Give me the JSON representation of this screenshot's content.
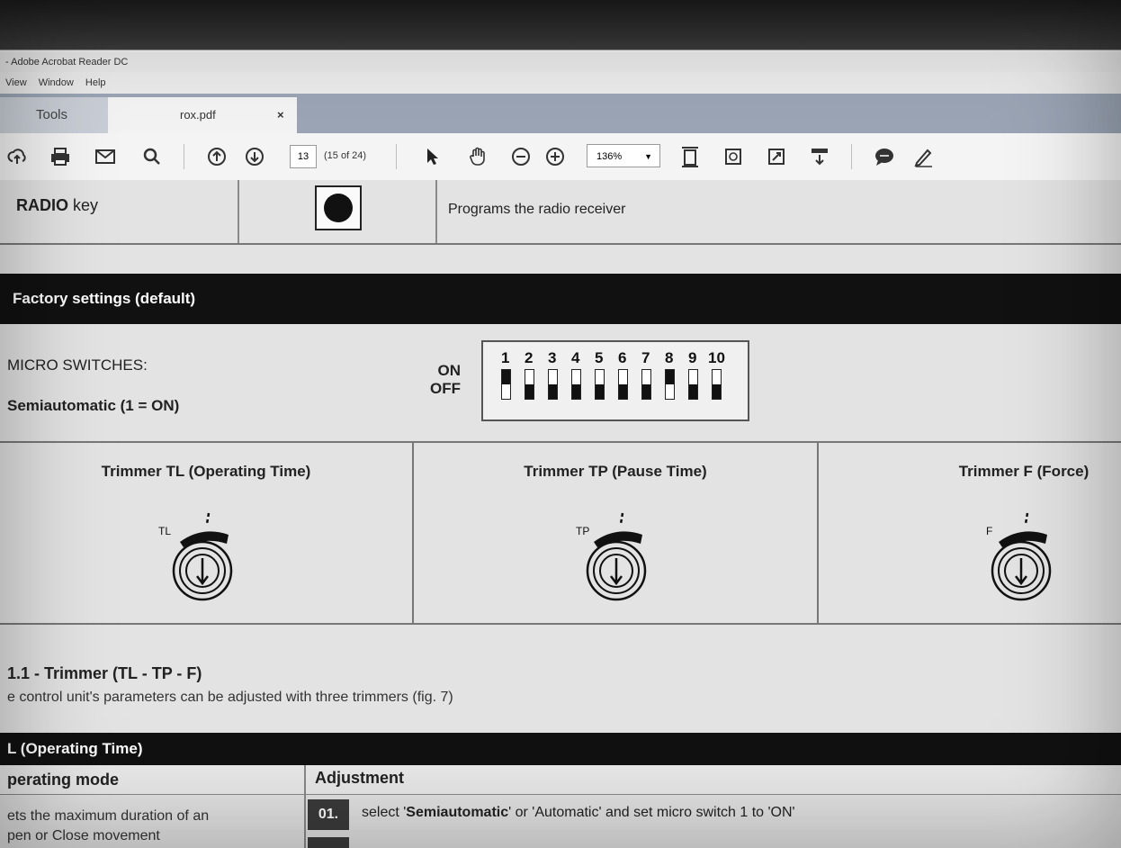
{
  "window": {
    "title": "- Adobe Acrobat Reader DC"
  },
  "menu": {
    "items": [
      "View",
      "Window",
      "Help"
    ]
  },
  "tabs": {
    "tools_label": "Tools",
    "doc_label": "rox.pdf",
    "close_label": "×"
  },
  "toolbar": {
    "page_current": "13",
    "page_of": "(15 of 24)",
    "zoom": "136%",
    "icons": [
      "cloud-upload-icon",
      "print-icon",
      "email-icon",
      "search-icon",
      "page-up-icon",
      "page-down-icon",
      "select-cursor-icon",
      "hand-tool-icon",
      "zoom-out-icon",
      "zoom-in-icon",
      "fit-page-icon",
      "rotate-icon",
      "fullscreen-icon",
      "read-mode-icon",
      "comment-icon",
      "pen-icon"
    ]
  },
  "document": {
    "radio_row": {
      "key_bold": "RADIO",
      "key_rest": " key",
      "description": "Programs the radio receiver"
    },
    "factory_title": "Factory settings (default)",
    "micro_label": "MICRO SWITCHES:",
    "semi_label": "Semiautomatic (1 = ON)",
    "on_label": "ON",
    "off_label": "OFF",
    "dip_switches": [
      {
        "n": "1",
        "on": true
      },
      {
        "n": "2",
        "on": false
      },
      {
        "n": "3",
        "on": false
      },
      {
        "n": "4",
        "on": false
      },
      {
        "n": "5",
        "on": false
      },
      {
        "n": "6",
        "on": false
      },
      {
        "n": "7",
        "on": false
      },
      {
        "n": "8",
        "on": true
      },
      {
        "n": "9",
        "on": false
      },
      {
        "n": "10",
        "on": false
      }
    ],
    "trimmers": [
      {
        "title": "Trimmer TL (Operating Time)",
        "tag": "TL"
      },
      {
        "title": "Trimmer TP (Pause Time)",
        "tag": "TP"
      },
      {
        "title": "Trimmer F (Force)",
        "tag": "F"
      }
    ],
    "section_title": "1.1 - Trimmer (TL - TP - F)",
    "section_text": "e control unit's parameters can be adjusted with three trimmers (fig. 7)",
    "tl_title": "L (Operating Time)",
    "table_header": {
      "mode": "perating mode",
      "adjustment": "Adjustment"
    },
    "mode_text_1": "ets the maximum duration of an",
    "mode_text_2": "pen or Close movement",
    "step": {
      "num": "01.",
      "pre": "select '",
      "bold": "Semiautomatic",
      "post": "' or 'Automatic' and set micro switch 1 to 'ON'"
    }
  }
}
